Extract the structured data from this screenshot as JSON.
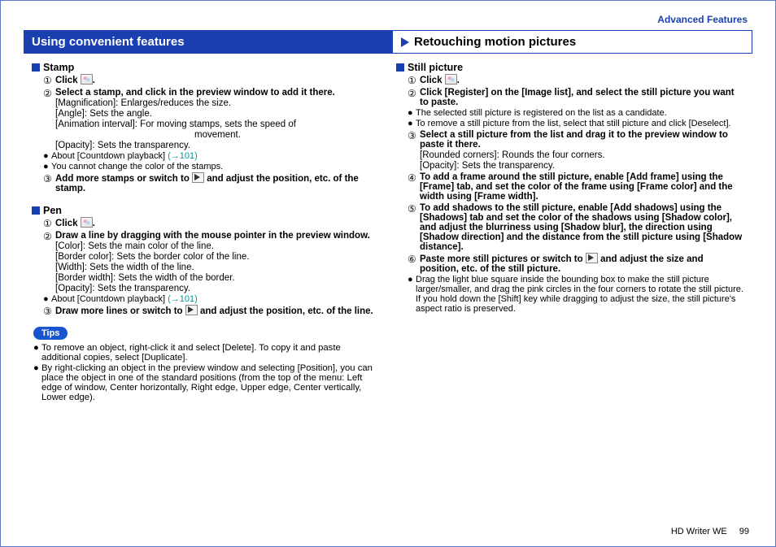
{
  "breadcrumb": "Advanced Features",
  "titlebar": {
    "left": "Using convenient features",
    "right": "Retouching motion pictures"
  },
  "left": {
    "stamp": {
      "title": "Stamp",
      "s1_lead": "Click ",
      "s1_tail": ".",
      "s2_lead": "Select a stamp, and click in the preview window to add it there.",
      "s2_a": "[Magnification]: Enlarges/reduces the size.",
      "s2_b": "[Angle]: Sets the angle.",
      "s2_c": "[Animation interval]: For moving stamps, sets the speed of",
      "s2_c2": "movement.",
      "s2_d": "[Opacity]: Sets the transparency.",
      "b1": "About [Countdown playback] ",
      "b1_link": "(→101)",
      "b2": "You cannot change the color of the stamps.",
      "s3_a": "Add more stamps or switch to ",
      "s3_b": " and adjust the position, etc. of the stamp."
    },
    "pen": {
      "title": "Pen",
      "s1_lead": "Click ",
      "s1_tail": ".",
      "s2_lead": "Draw a line by dragging with the mouse pointer in the preview window.",
      "s2_a": "[Color]: Sets the main color of the line.",
      "s2_b": "[Border color]: Sets the border color of the line.",
      "s2_c": "[Width]: Sets the width of the line.",
      "s2_d": "[Border width]: Sets the width of the border.",
      "s2_e": "[Opacity]: Sets the transparency.",
      "b1": "About [Countdown playback] ",
      "b1_link": "(→101)",
      "s3_a": "Draw more lines or switch to ",
      "s3_b": " and adjust the position, etc. of the line."
    },
    "tips": {
      "label": "Tips",
      "t1": "To remove an object, right-click it and select [Delete]. To copy it and paste additional copies, select [Duplicate].",
      "t2": "By right-clicking an object in the preview window and selecting [Position], you can place the object in one of the standard positions (from the top of the menu: Left edge of window, Center horizontally, Right edge, Upper edge, Center vertically, Lower edge)."
    }
  },
  "right": {
    "still": {
      "title": "Still picture",
      "s1_lead": "Click ",
      "s1_tail": ".",
      "s2_lead": "Click [Register] on the [Image list], and select the still picture you want to paste.",
      "b1": "The selected still picture is registered on the list as a candidate.",
      "b2": "To remove a still picture from the list, select that still picture and click [Deselect].",
      "s3_lead": "Select a still picture from the list and drag it to the preview window to paste it there.",
      "s3_a": "[Rounded corners]: Rounds the four corners.",
      "s3_b": "[Opacity]: Sets the transparency.",
      "s4_lead": "To add a frame around the still picture, enable [Add frame] using the [Frame] tab, and set the color of the frame using [Frame color] and the width using [Frame width].",
      "s5_lead": "To add shadows to the still picture, enable [Add shadows] using the [Shadows] tab and set the color of the shadows using [Shadow color], and adjust the blurriness using [Shadow blur], the direction using [Shadow direction] and the distance from the still picture using [Shadow distance].",
      "s6_a": "Paste more still pictures or switch to ",
      "s6_b": " and adjust the size and position, etc. of the still picture.",
      "b3": "Drag the light blue square inside the bounding box to make the still picture larger/smaller, and drag the pink circles in the four corners to rotate the still picture.",
      "b3b": "If you hold down the [Shift] key while dragging to adjust the size, the still picture's aspect ratio is preserved."
    }
  },
  "footer": {
    "product": "HD Writer WE",
    "page": "99"
  }
}
